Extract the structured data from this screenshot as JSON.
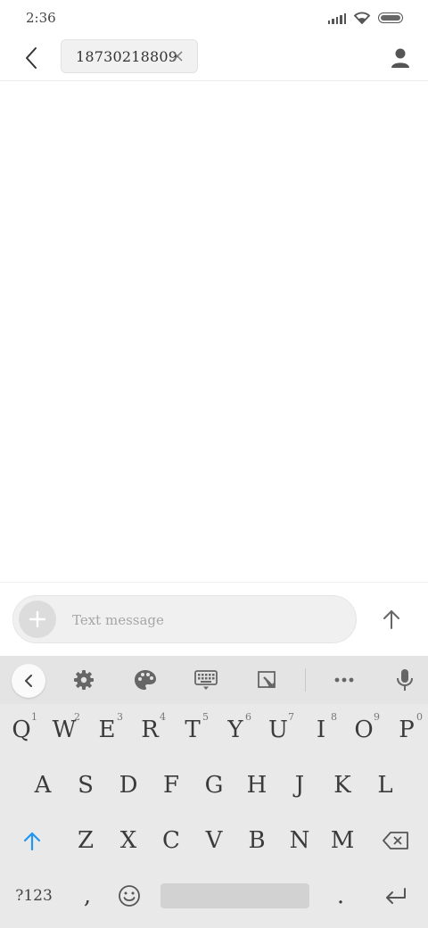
{
  "status_bar": {
    "time": "2:36"
  },
  "header": {
    "recipient": "18730218809"
  },
  "compose": {
    "placeholder": "Text message",
    "value": ""
  },
  "keyboard": {
    "row1": [
      {
        "key": "Q",
        "hint": "1"
      },
      {
        "key": "W",
        "hint": "2"
      },
      {
        "key": "E",
        "hint": "3"
      },
      {
        "key": "R",
        "hint": "4"
      },
      {
        "key": "T",
        "hint": "5"
      },
      {
        "key": "Y",
        "hint": "6"
      },
      {
        "key": "U",
        "hint": "7"
      },
      {
        "key": "I",
        "hint": "8"
      },
      {
        "key": "O",
        "hint": "9"
      },
      {
        "key": "P",
        "hint": "0"
      }
    ],
    "row2": [
      "A",
      "S",
      "D",
      "F",
      "G",
      "H",
      "J",
      "K",
      "L"
    ],
    "row3": [
      "Z",
      "X",
      "C",
      "V",
      "B",
      "N",
      "M"
    ],
    "symbols_label": "?123",
    "comma": ",",
    "period": "."
  },
  "colors": {
    "accent": "#2196f3",
    "keyboard_bg": "#e9e9e9",
    "toolbar_bg": "#e4e4e4"
  }
}
